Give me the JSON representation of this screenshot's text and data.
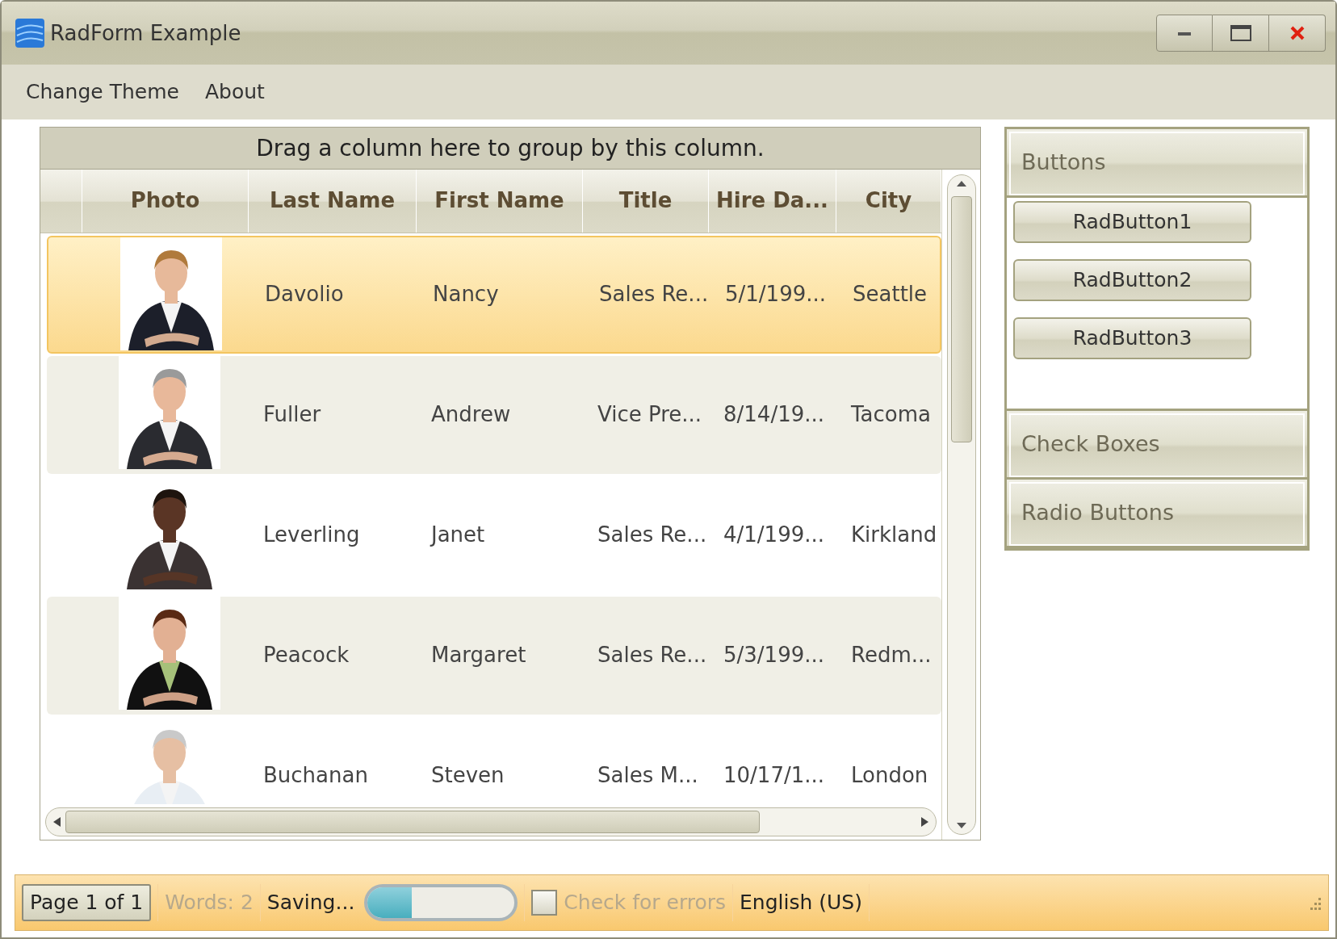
{
  "window": {
    "title": "RadForm Example"
  },
  "menu": [
    "Change Theme",
    "About"
  ],
  "grid": {
    "group_panel": "Drag a column here to group by this column.",
    "columns": [
      "",
      "Photo",
      "Last Name",
      "First Name",
      "Title",
      "Hire Da...",
      "City"
    ],
    "rows": [
      {
        "selected": true,
        "cells": [
          "",
          {
            "kind": "picture"
          },
          "Davolio",
          "Nancy",
          "Sales Re...",
          "5/1/199...",
          "Seattle"
        ]
      },
      {
        "selected": false,
        "cells": [
          "",
          {
            "kind": "picture"
          },
          "Fuller",
          "Andrew",
          "Vice Pre...",
          "8/14/19...",
          "Tacoma"
        ]
      },
      {
        "selected": false,
        "cells": [
          "",
          {
            "kind": "picture"
          },
          "Leverling",
          "Janet",
          "Sales Re...",
          "4/1/199...",
          "Kirkland"
        ]
      },
      {
        "selected": false,
        "cells": [
          "",
          {
            "kind": "picture"
          },
          "Peacock",
          "Margaret",
          "Sales Re...",
          "5/3/199...",
          "Redm..."
        ]
      },
      {
        "selected": false,
        "cells": [
          "",
          {
            "kind": "picture"
          },
          "Buchanan",
          "Steven",
          "Sales M...",
          "10/17/1...",
          "London"
        ]
      }
    ]
  },
  "panel_bar": [
    {
      "title": "Buttons",
      "buttons": [
        "RadButton1",
        "RadButton2",
        "RadButton3"
      ]
    },
    {
      "title": "Check Boxes"
    },
    {
      "title": "Radio Buttons"
    }
  ],
  "status_bar": {
    "page": "Page 1 of 1",
    "words": {
      "text": "Words: 2",
      "disabled": true
    },
    "saving": "Saving...",
    "progress": {
      "level": 0.3
    },
    "check": {
      "label": "Check for errors",
      "checked": false
    },
    "language": "English (US)"
  }
}
